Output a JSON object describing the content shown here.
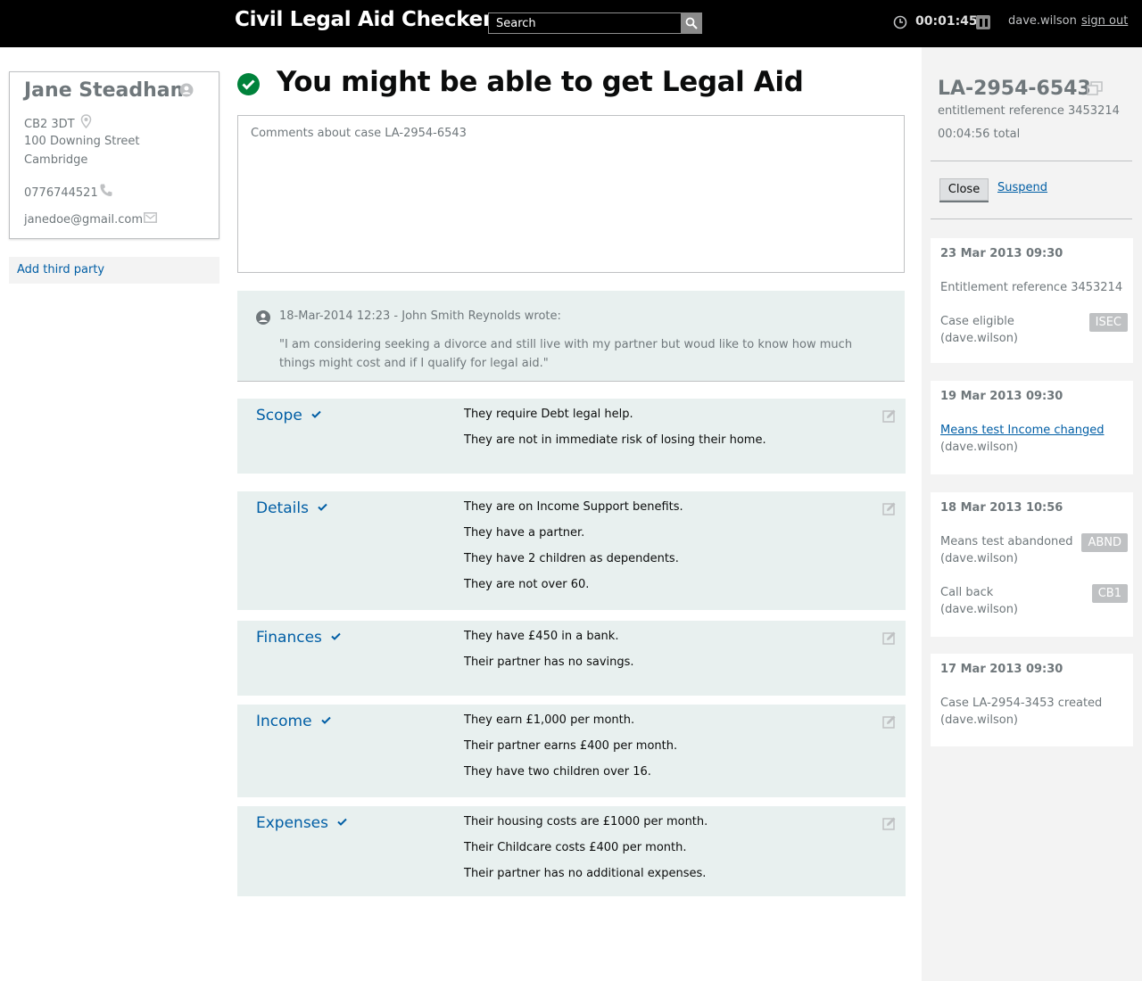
{
  "header": {
    "app_title": "Civil Legal Aid Checker",
    "search_placeholder": "Search",
    "timer": "00:01:45",
    "username": "dave.wilson",
    "signout_label": "sign out"
  },
  "contact": {
    "name": "Jane Steadham",
    "postcode": "CB2 3DT",
    "street": "100 Downing Street",
    "city": "Cambridge",
    "phone": "0776744521",
    "email": "janedoe@gmail.com"
  },
  "add_third_party_label": "Add third party",
  "result": {
    "title": "You might be able to get Legal Aid"
  },
  "comments": {
    "placeholder": "Comments about case LA-2954-6543"
  },
  "note": {
    "meta": "18-Mar-2014 12:23 - John Smith Reynolds wrote:",
    "text": "\"I am considering seeking a divorce and still live with my partner but woud like to know how much things might cost and if I qualify for legal aid.\""
  },
  "sections": [
    {
      "title": "Scope",
      "facts": [
        "They require Debt legal help.",
        "They are not in immediate risk of losing their home."
      ]
    },
    {
      "title": "Details",
      "facts": [
        "They are on Income Support benefits.",
        "They have a partner.",
        "They have 2 children as dependents.",
        "They are not over 60."
      ]
    },
    {
      "title": "Finances",
      "facts": [
        "They have £450 in a bank.",
        "Their partner has no savings."
      ]
    },
    {
      "title": "Income",
      "facts": [
        "They earn £1,000 per month.",
        "Their partner earns £400 per month.",
        "They have two children over 16."
      ]
    },
    {
      "title": "Expenses",
      "facts": [
        "Their housing costs are £1000 per month.",
        "Their Childcare costs £400 per month.",
        "Their partner has no additional expenses."
      ]
    }
  ],
  "case": {
    "reference": "LA-2954-6543",
    "entitlement": "entitlement reference 3453214",
    "total": "00:04:56 total",
    "close_label": "Close",
    "suspend_label": "Suspend"
  },
  "events": [
    {
      "date": "23 Mar 2013 09:30",
      "items": [
        {
          "text": "Entitlement reference 3453214"
        },
        {
          "text": "Case eligible",
          "user": "(dave.wilson)",
          "badge": "ISEC"
        }
      ]
    },
    {
      "date": "19 Mar 2013 09:30",
      "items": [
        {
          "link": "Means test Income changed",
          "user": "(dave.wilson)"
        }
      ]
    },
    {
      "date": "18 Mar 2013 10:56",
      "items": [
        {
          "text": "Means test abandoned",
          "user": "(dave.wilson)",
          "badge": "ABND"
        },
        {
          "text": "Call back",
          "user": "(dave.wilson)",
          "badge": "CB1"
        }
      ]
    },
    {
      "date": "17 Mar 2013 09:30",
      "items": [
        {
          "text": "Case LA-2954-3453 created",
          "user": "(dave.wilson)"
        }
      ]
    }
  ],
  "colors": {
    "header_bg": "#000000",
    "link": "#005ea5",
    "success": "#00823b",
    "section_bg": "#e8f0ef",
    "panel_bg": "#f3f3f3",
    "badge_bg": "#bfc1c3"
  }
}
